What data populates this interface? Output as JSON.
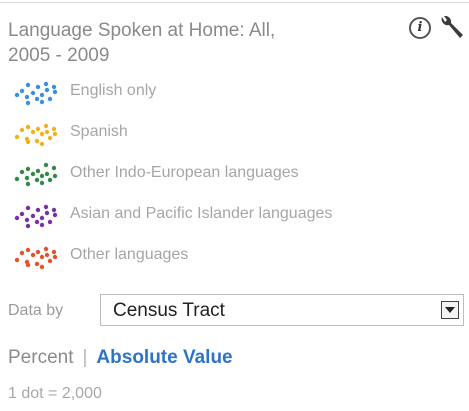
{
  "panel": {
    "title_line1": "Language Spoken at Home: All,",
    "title_line2": "2005 - 2009",
    "info_icon": "info-icon",
    "settings_icon": "wrench-icon"
  },
  "legend": {
    "items": [
      {
        "label": "English only",
        "color": "#3a8fe0"
      },
      {
        "label": "Spanish",
        "color": "#f0b21a"
      },
      {
        "label": "Other Indo-European languages",
        "color": "#2f8a45"
      },
      {
        "label": "Asian and Pacific Islander languages",
        "color": "#7a2fa8"
      },
      {
        "label": "Other languages",
        "color": "#e8512a"
      }
    ]
  },
  "data_by": {
    "label": "Data by",
    "selected": "Census Tract"
  },
  "toggle": {
    "percent_label": "Percent",
    "separator": "|",
    "absolute_label": "Absolute Value"
  },
  "scale": {
    "dot_value_text": "1 dot = 2,000"
  }
}
